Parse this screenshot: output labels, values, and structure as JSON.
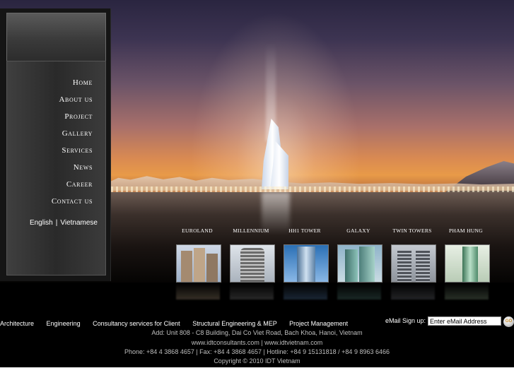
{
  "nav": {
    "items": [
      {
        "label": "Home"
      },
      {
        "label": "About us"
      },
      {
        "label": "Project"
      },
      {
        "label": "Gallery"
      },
      {
        "label": "Services"
      },
      {
        "label": "News"
      },
      {
        "label": "Career"
      },
      {
        "label": "Contact us"
      }
    ],
    "languages": {
      "english": "English",
      "separator": "|",
      "vietnamese": "Vietnamese"
    }
  },
  "projects": [
    {
      "label": "Euroland",
      "color": "#b9a38c"
    },
    {
      "label": "Millennium",
      "color": "#8f8f8f"
    },
    {
      "label": "HH1 Tower",
      "color": "#5e88b8"
    },
    {
      "label": "Galaxy",
      "color": "#5d8f86"
    },
    {
      "label": "Twin Towers",
      "color": "#7c7f88"
    },
    {
      "label": "Pham Hung",
      "color": "#8ea88a"
    }
  ],
  "footer": {
    "links": [
      "Architecture",
      "Engineering",
      "Consultancy services for Client",
      "Structural Engineering & MEP",
      "Project Management"
    ],
    "signup_label": "eMail Sign up:",
    "signup_placeholder": "Enter eMail Address",
    "go_label": "GO",
    "address": "Add: Unit 808 - C8 Building, Dai Co Viet Road, Bach Khoa, Hanoi, Vietnam",
    "websites": "www.idtconsultants.com | www.idtvietnam.com",
    "phone": "Phone: +84 4 3868 4657 | Fax: +84 4 3868 4657 | Hotline: +84 9 15131818 / +84 9 8963 6466",
    "copyright": "Copyright © 2010 IDT Vietnam"
  }
}
